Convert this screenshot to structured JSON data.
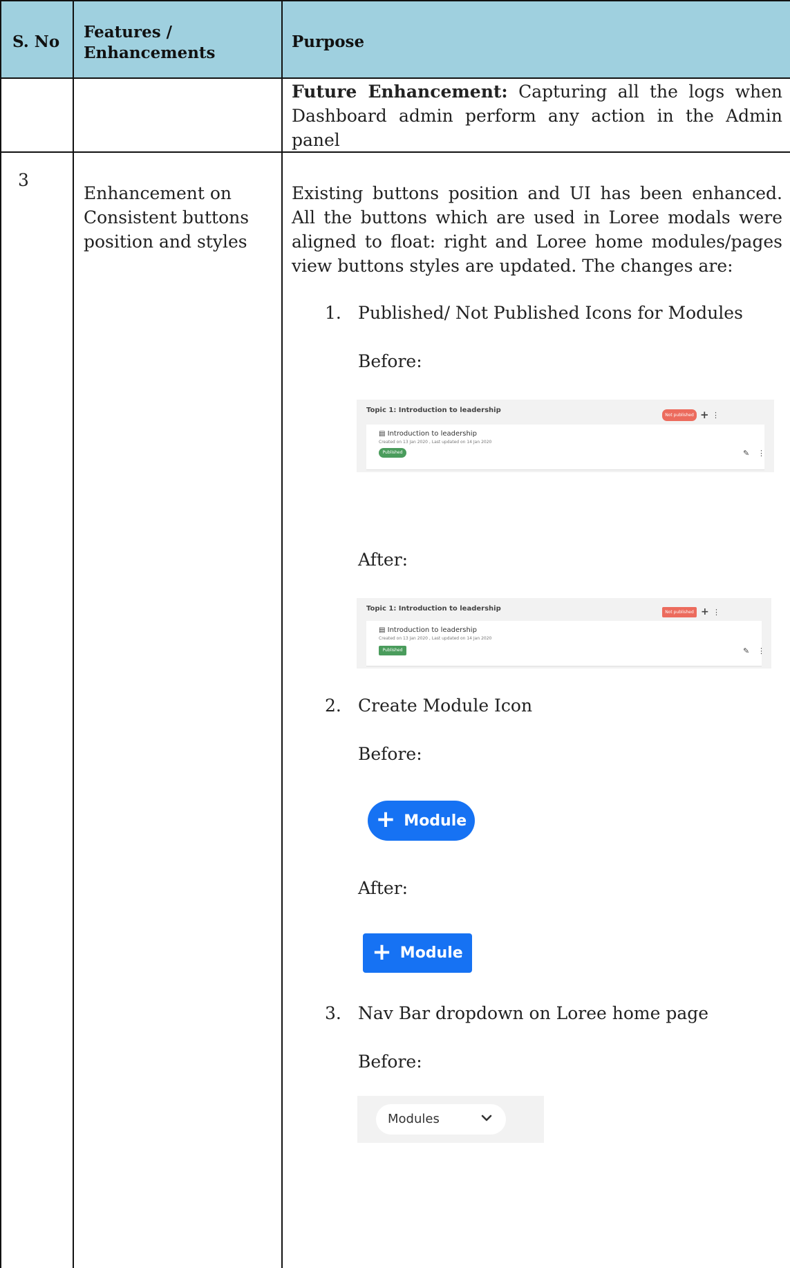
{
  "header": {
    "col1": "S. No",
    "col2_line1": "Features /",
    "col2_line2": "Enhancements",
    "col3": "Purpose"
  },
  "row_continued": {
    "bold_prefix": "Future Enhancement:",
    "text": "Capturing all the logs when Dashboard admin perform any action in the Admin panel"
  },
  "row3": {
    "sno": "3",
    "feature_line1": "Enhancement on",
    "feature_line2": "Consistent buttons",
    "feature_line3": "position and styles",
    "intro": "Existing buttons position and UI has been enhanced. All the buttons which are used in Loree modals were aligned to float: right and Loree home modules/pages view buttons styles are updated. The changes are:",
    "items": [
      {
        "num": "1.",
        "title": "Published/ Not Published Icons for Modules"
      },
      {
        "num": "2.",
        "title": "Create Module Icon"
      },
      {
        "num": "3.",
        "title": "Nav Bar dropdown on Loree home page"
      }
    ],
    "labels": {
      "before": "Before:",
      "after": "After:"
    }
  },
  "screenshot_module": {
    "topic": "Topic 1: Introduction to leadership",
    "not_published": "Not published",
    "lesson": "Introduction to leadership",
    "meta": "Created on 13 Jan 2020 , Last updated on 14 Jan 2020",
    "published": "Published"
  },
  "module_button": {
    "label": "Module",
    "color": "#1672f3"
  },
  "nav_dropdown": {
    "label": "Modules"
  },
  "colors": {
    "header_bg": "#9fd0df",
    "published_green": "#4a9c5c",
    "not_published_red": "#ec6b5d"
  }
}
